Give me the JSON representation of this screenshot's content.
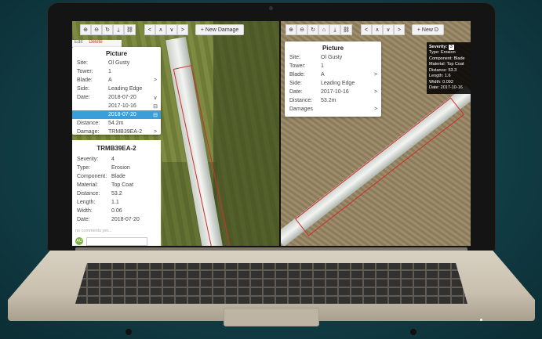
{
  "toolbar_left": {
    "icons": [
      "zoom-in-icon",
      "zoom-out-icon",
      "refresh-icon",
      "download-icon",
      "link-icon"
    ],
    "glyphs": [
      "⊕",
      "⊖",
      "↻",
      "⤓",
      "⛓"
    ],
    "nav": [
      "<",
      "∧",
      "∨",
      ">"
    ],
    "new_damage": "+ New Damage"
  },
  "toolbar_right": {
    "glyphs": [
      "⊕",
      "⊖",
      "↻",
      "⌂",
      "⤓",
      "⛓"
    ],
    "nav": [
      "<",
      "∧",
      "∨",
      ">"
    ],
    "new_damage": "+ New D"
  },
  "mini_tabs": {
    "edit": "Edit",
    "delete": "Delete"
  },
  "left_picture": {
    "title": "Picture",
    "rows": [
      {
        "k": "Site:",
        "v": "Ol Gusty",
        "a": ""
      },
      {
        "k": "Tower:",
        "v": "1",
        "a": ""
      },
      {
        "k": "Blade:",
        "v": "A",
        "a": ">"
      },
      {
        "k": "Side:",
        "v": "Leading Edge",
        "a": ""
      },
      {
        "k": "Date:",
        "v": "2018-07-20",
        "a": "∨"
      },
      {
        "k": "",
        "v": "2017-10-16",
        "a": "⊟"
      },
      {
        "k": "",
        "v": "2018-07-20",
        "a": "⊟"
      },
      {
        "k": "Distance:",
        "v": "54.2m",
        "a": ""
      },
      {
        "k": "Damage:",
        "v": "TRMB39EA-2",
        "a": ">"
      }
    ],
    "selected_index": 6
  },
  "damage_detail": {
    "title": "TRMB39EA-2",
    "rows": [
      {
        "k": "Severity:",
        "v": "4"
      },
      {
        "k": "Type:",
        "v": "Erosion"
      },
      {
        "k": "Component:",
        "v": "Blade"
      },
      {
        "k": "Material:",
        "v": "Top Coat"
      },
      {
        "k": "Distance:",
        "v": "53.2"
      },
      {
        "k": "Length:",
        "v": "1.1"
      },
      {
        "k": "Width:",
        "v": "0.06"
      },
      {
        "k": "Date:",
        "v": "2018-07-20"
      }
    ],
    "comment_placeholder": "no comments yet...",
    "avatar": "AU"
  },
  "right_picture": {
    "title": "Picture",
    "rows": [
      {
        "k": "Site:",
        "v": "Ol Gusty",
        "a": ""
      },
      {
        "k": "Tower:",
        "v": "1",
        "a": ""
      },
      {
        "k": "Blade:",
        "v": "A",
        "a": ">"
      },
      {
        "k": "Side:",
        "v": "Leading Edge",
        "a": ""
      },
      {
        "k": "Date:",
        "v": "2017-10-16",
        "a": ">"
      },
      {
        "k": "Distance:",
        "v": "53.2m",
        "a": ""
      },
      {
        "k": "Damages",
        "v": "",
        "a": ">"
      }
    ]
  },
  "tooltip": {
    "severity_label": "Severity:",
    "severity": "3",
    "lines": [
      "Type: Erosion",
      "Component: Blade",
      "Material: Top Coat",
      "Distance: 53.3",
      "Length: 1.6",
      "Width: 0.092",
      "Date: 2017-10-16"
    ]
  },
  "colors": {
    "selection": "#3a9fd9",
    "damage_box": "#d22c2c",
    "background": "#1d5c63"
  }
}
